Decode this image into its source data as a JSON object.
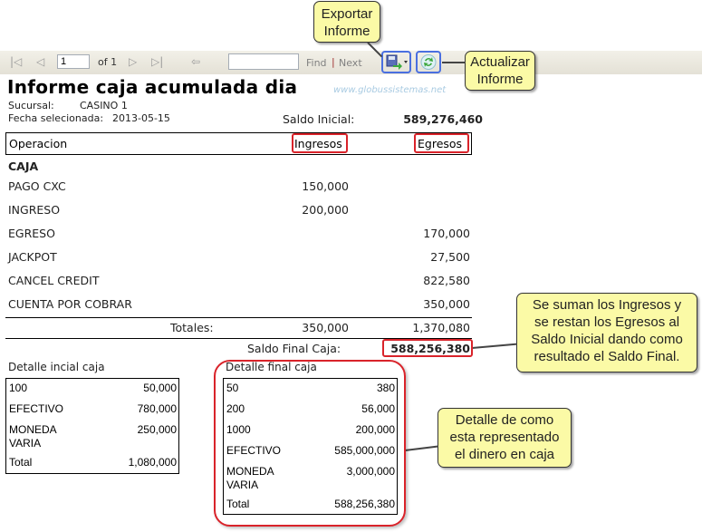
{
  "toolbar": {
    "page_value": "1",
    "of_label": "of 1",
    "find_placeholder": "",
    "find_label": "Find",
    "separator": "|",
    "next_label": "Next",
    "icons": [
      "first-page-icon",
      "previous-page-icon",
      "next-page-icon",
      "last-page-icon",
      "back-icon",
      "export-icon",
      "refresh-icon"
    ]
  },
  "callouts": {
    "export": "Exportar\nInforme",
    "refresh": "Actualizar\nInforme",
    "saldo": "Se suman los Ingresos y\nse restan los Egresos al\nSaldo Inicial dando como\nresultado el Saldo Final.",
    "detalle": "Detalle de como\nesta representado\nel dinero en caja"
  },
  "report": {
    "title": "Informe caja acumulada dia",
    "watermark": "www.globussistemas.net",
    "sucursal_label": "Sucursal:",
    "sucursal_value": "CASINO 1",
    "fecha_label": "Fecha selecionada:",
    "fecha_value": "2013-05-15",
    "saldo_inicial_label": "Saldo Inicial:",
    "saldo_inicial_value": "589,276,460",
    "columns": {
      "operacion": "Operacion",
      "ingresos": "Ingresos",
      "egresos": "Egresos"
    },
    "group": "CAJA",
    "rows": [
      {
        "label": "PAGO CXC",
        "ingreso": "150,000",
        "egreso": ""
      },
      {
        "label": "INGRESO",
        "ingreso": "200,000",
        "egreso": ""
      },
      {
        "label": "EGRESO",
        "ingreso": "",
        "egreso": "170,000"
      },
      {
        "label": "JACKPOT",
        "ingreso": "",
        "egreso": "27,500"
      },
      {
        "label": "CANCEL CREDIT",
        "ingreso": "",
        "egreso": "822,580"
      },
      {
        "label": "CUENTA POR COBRAR",
        "ingreso": "",
        "egreso": "350,000"
      }
    ],
    "totales_label": "Totales:",
    "totales_ingresos": "350,000",
    "totales_egresos": "1,370,080",
    "saldo_final_label": "Saldo Final Caja:",
    "saldo_final_value": "588,256,380",
    "detalle_inicial": {
      "title": "Detalle incial caja",
      "rows": [
        {
          "label": "100",
          "value": "50,000"
        },
        {
          "label": "EFECTIVO",
          "value": "780,000"
        },
        {
          "label": "MONEDA VARIA",
          "value": "250,000"
        },
        {
          "label": "Total",
          "value": "1,080,000"
        }
      ]
    },
    "detalle_final": {
      "title": "Detalle final caja",
      "rows": [
        {
          "label": "50",
          "value": "380"
        },
        {
          "label": "200",
          "value": "56,000"
        },
        {
          "label": "1000",
          "value": "200,000"
        },
        {
          "label": "EFECTIVO",
          "value": "585,000,000"
        },
        {
          "label": "MONEDA VARIA",
          "value": "3,000,000"
        },
        {
          "label": "Total",
          "value": "588,256,380"
        }
      ]
    }
  },
  "colors": {
    "highlight_red": "#d9232a",
    "highlight_blue": "#4a6fe0",
    "callout_bg": "#fbfaa6",
    "watermark": "#a9cbe2"
  }
}
